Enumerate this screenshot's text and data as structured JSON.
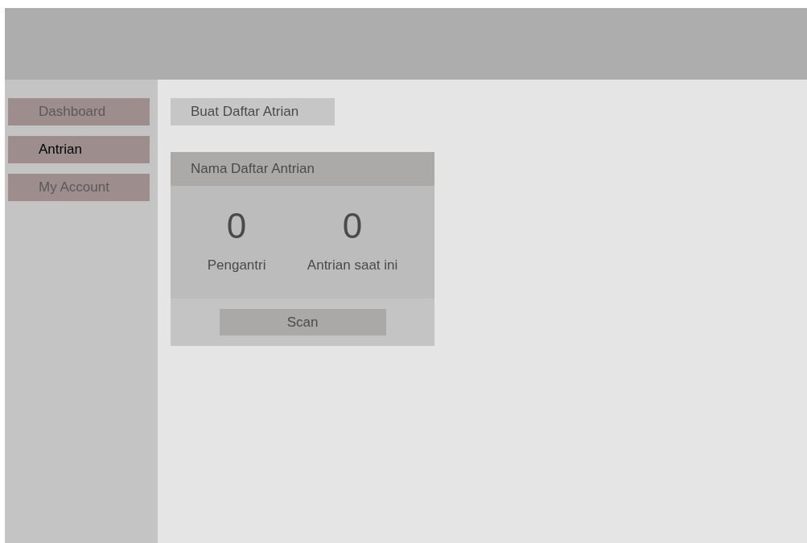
{
  "sidebar": {
    "items": [
      {
        "label": "Dashboard",
        "selected": false
      },
      {
        "label": "Antrian",
        "selected": true
      },
      {
        "label": "My Account",
        "selected": false
      }
    ]
  },
  "create_button": "Buat Daftar Atrian",
  "queue_card": {
    "title": "Nama Daftar Antrian",
    "stats": [
      {
        "value": "0",
        "label": "Pengantri"
      },
      {
        "value": "0",
        "label": "Antrian saat ini"
      }
    ],
    "scan_button": "Scan"
  }
}
